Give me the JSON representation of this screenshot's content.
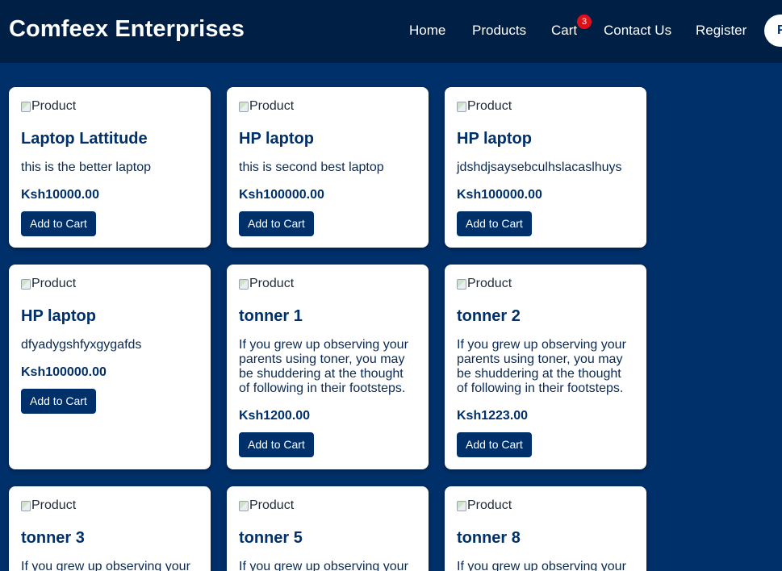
{
  "header": {
    "brand": "Comfeex Enterprises",
    "nav": {
      "home": "Home",
      "products": "Products",
      "cart": "Cart",
      "cart_count": "3",
      "contact": "Contact Us",
      "register": "Register",
      "profile_initial": "F"
    }
  },
  "products": [
    {
      "image_alt": "Product",
      "title": "Laptop Lattitude",
      "description": "this is the better laptop",
      "price": "Ksh10000.00",
      "button": "Add to Cart"
    },
    {
      "image_alt": "Product",
      "title": "HP laptop",
      "description": "this is second best laptop",
      "price": "Ksh100000.00",
      "button": "Add to Cart"
    },
    {
      "image_alt": "Product",
      "title": "HP laptop",
      "description": "jdshdjsaysebculhslacaslhuys",
      "price": "Ksh100000.00",
      "button": "Add to Cart"
    },
    {
      "image_alt": "Product",
      "title": "HP laptop",
      "description": "dfyadygshfyxgygafds",
      "price": "Ksh100000.00",
      "button": "Add to Cart"
    },
    {
      "image_alt": "Product",
      "title": "tonner 1",
      "description": "If you grew up observing your parents using toner, you may be shuddering at the thought of following in their footsteps.",
      "price": "Ksh1200.00",
      "button": "Add to Cart"
    },
    {
      "image_alt": "Product",
      "title": "tonner 2",
      "description": "If you grew up observing your parents using toner, you may be shuddering at the thought of following in their footsteps.",
      "price": "Ksh1223.00",
      "button": "Add to Cart"
    },
    {
      "image_alt": "Product",
      "title": "tonner 3",
      "description": "If you grew up observing your",
      "price": "",
      "button": ""
    },
    {
      "image_alt": "Product",
      "title": "tonner 5",
      "description": "If you grew up observing your",
      "price": "",
      "button": ""
    },
    {
      "image_alt": "Product",
      "title": "tonner 8",
      "description": "If you grew up observing your",
      "price": "",
      "button": ""
    }
  ],
  "colors": {
    "header_bg": "#001f45",
    "page_bg": "#00306a",
    "accent": "#00306a",
    "badge": "#e0101a"
  }
}
